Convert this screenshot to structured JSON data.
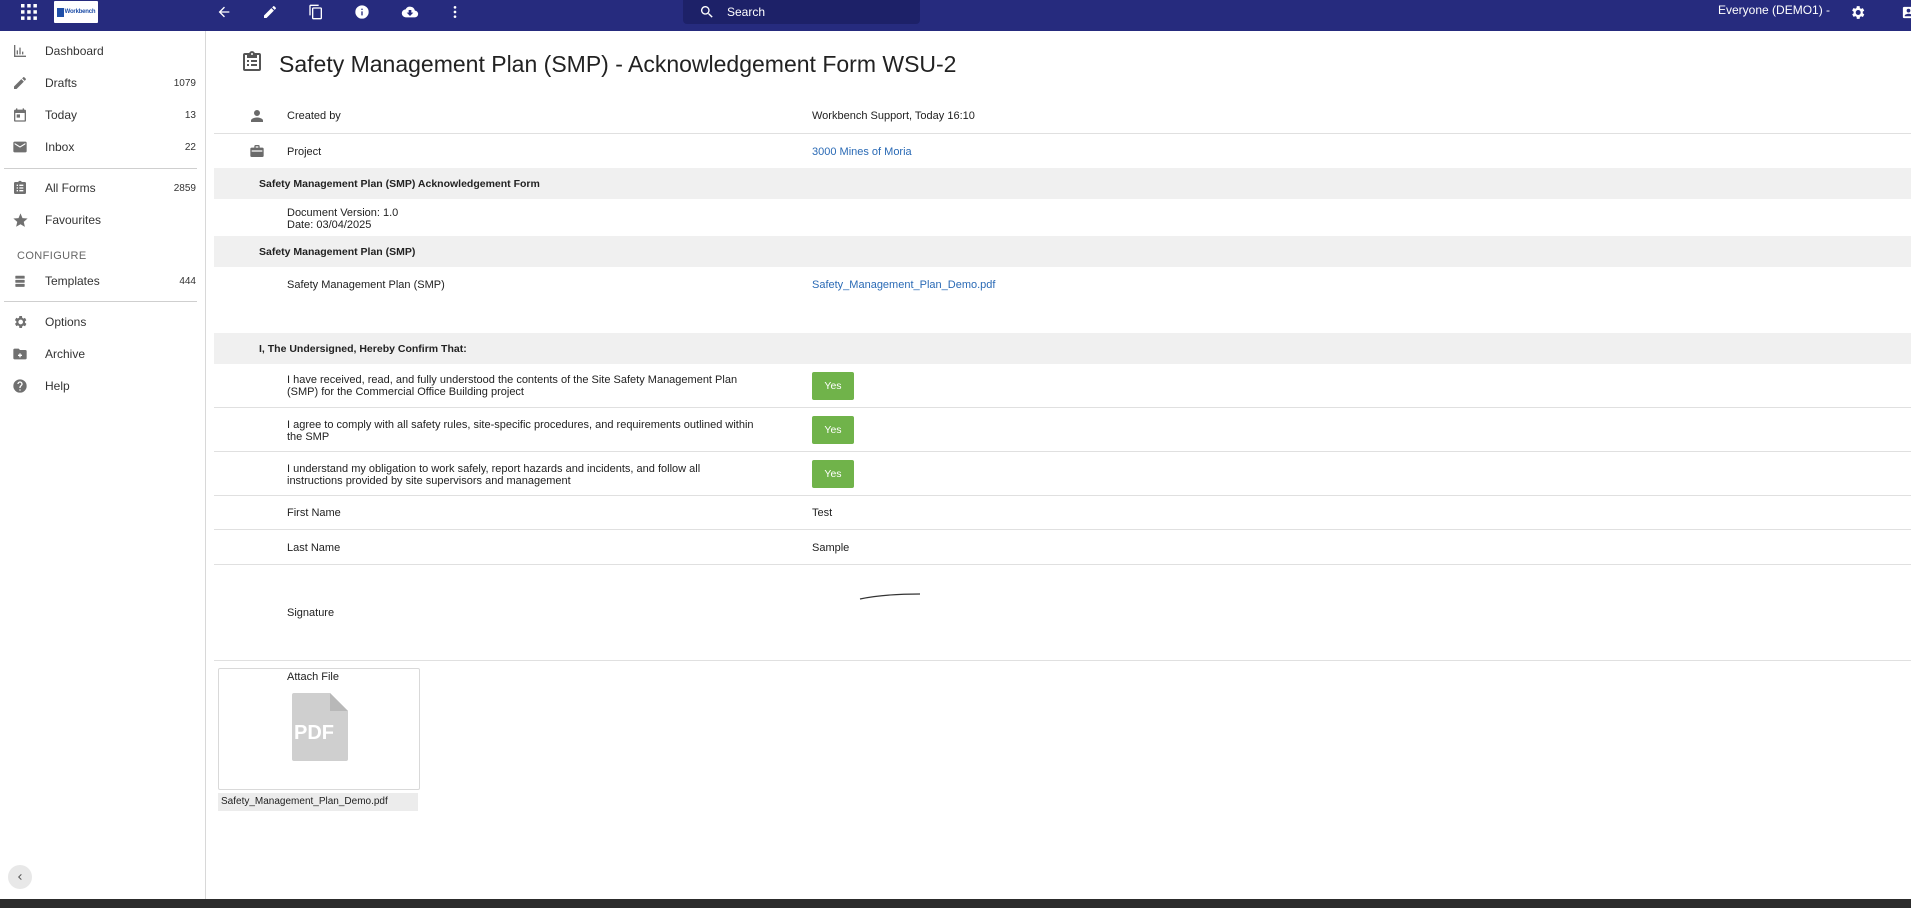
{
  "header": {
    "logo_text": "Workbench",
    "search_placeholder": "Search",
    "org_selector": "Everyone (DEMO1) -"
  },
  "sidebar": {
    "items": [
      {
        "label": "Dashboard",
        "count": ""
      },
      {
        "label": "Drafts",
        "count": "1079"
      },
      {
        "label": "Today",
        "count": "13"
      },
      {
        "label": "Inbox",
        "count": "22"
      },
      {
        "label": "All Forms",
        "count": "2859"
      },
      {
        "label": "Favourites",
        "count": ""
      },
      {
        "label": "Templates",
        "count": "444"
      },
      {
        "label": "Options",
        "count": ""
      },
      {
        "label": "Archive",
        "count": ""
      },
      {
        "label": "Help",
        "count": ""
      }
    ],
    "configure_heading": "CONFIGURE"
  },
  "form": {
    "title": "Safety Management Plan (SMP) - Acknowledgement Form WSU-2",
    "created_by_label": "Created by",
    "created_by_value": "Workbench Support, Today 16:10",
    "project_label": "Project",
    "project_value": "3000 Mines of Moria",
    "section1_heading": "Safety Management Plan (SMP) Acknowledgement Form",
    "doc_version": "Document Version: 1.0",
    "doc_date": "Date: 03/04/2025",
    "section2_heading": "Safety Management Plan (SMP)",
    "smp_label": "Safety Management Plan (SMP)",
    "smp_file": "Safety_Management_Plan_Demo.pdf",
    "section3_heading": "I, The Undersigned, Hereby Confirm That:",
    "confirmations": [
      {
        "line1": "I have received, read, and fully understood the contents of the Site Safety Management Plan",
        "line2": "(SMP) for the Commercial Office Building project",
        "answer": "Yes"
      },
      {
        "line1": "I agree to comply with all safety rules, site-specific procedures, and requirements outlined within",
        "line2": "the SMP",
        "answer": "Yes"
      },
      {
        "line1": "I understand my obligation to work safely, report hazards and incidents, and follow all",
        "line2": "instructions provided by site supervisors and management",
        "answer": "Yes"
      }
    ],
    "first_name_label": "First Name",
    "first_name_value": "Test",
    "last_name_label": "Last Name",
    "last_name_value": "Sample",
    "signature_label": "Signature",
    "attach_label": "Attach File",
    "attachment_icon_text": "PDF",
    "attachment_filename": "Safety_Management_Plan_Demo.pdf"
  },
  "colors": {
    "topbar": "#262b7e",
    "accent_link": "#2a6ab5",
    "yes_button": "#70b34a"
  }
}
